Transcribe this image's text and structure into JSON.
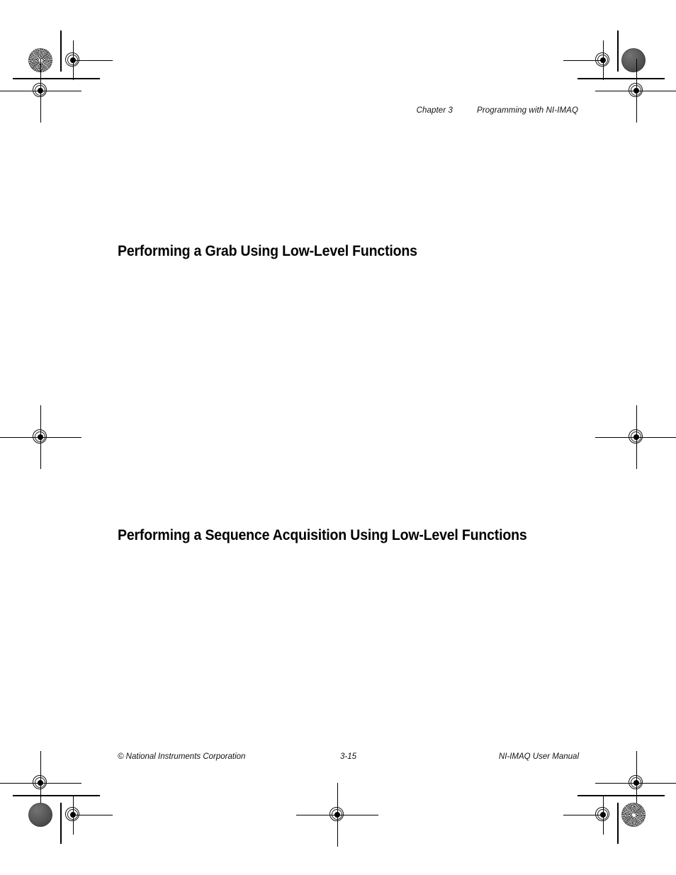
{
  "document": {
    "title": "NI-IMAQ User Manual",
    "page_number": "3-15",
    "chapter_label": "Chapter 3",
    "chapter_title": "Programming with NI-IMAQ"
  },
  "header": {
    "chapter_label": "Chapter 3",
    "chapter_title": "Programming with NI-IMAQ"
  },
  "body": {
    "headings": [
      {
        "text": "Performing a Grab Using Low-Level Functions"
      },
      {
        "text": "Performing a Sequence Acquisition Using Low-Level Functions"
      }
    ]
  },
  "footer": {
    "left": "© National Instruments Corporation",
    "center": "3-15",
    "right": "NI-IMAQ User Manual"
  },
  "printer_marks": {
    "registration_target_name": "registration-target-icon",
    "solid_density_patch_name": "solid-density-patch-icon",
    "halftone_star_patch_name": "halftone-star-target-icon",
    "trim_line_name": "trim-line",
    "colors": {
      "ink": "#000000",
      "solid_patch": "#555555",
      "page_background": "#ffffff"
    }
  }
}
